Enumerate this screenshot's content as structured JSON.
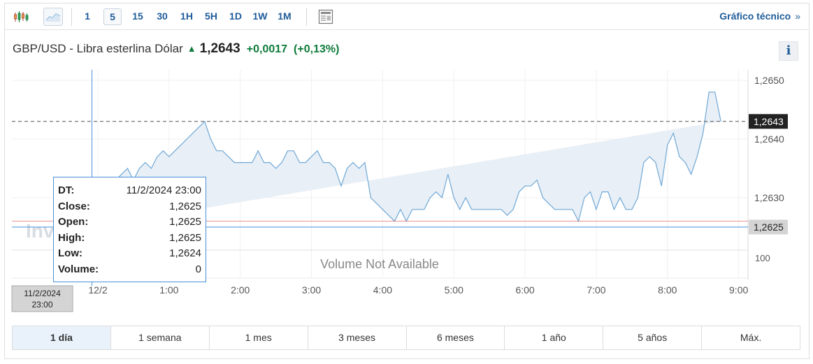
{
  "toolbar": {
    "intervals": [
      "1",
      "5",
      "15",
      "30",
      "1H",
      "5H",
      "1D",
      "1W",
      "1M"
    ],
    "active_interval": "5",
    "tech_link": "Gráfico técnico",
    "tech_link_chevron": "»"
  },
  "header": {
    "pair": "GBP/USD - Libra esterlina Dólar",
    "price": "1,2643",
    "change": "+0,0017",
    "change_pct": "(+0,13%)",
    "info": "i"
  },
  "colors": {
    "accent": "#1f5c99",
    "positive": "#0e7b3a",
    "line": "#6fa8d6",
    "area": "#e8eff6",
    "crosshair": "#4a90d9",
    "ref_line": "#e36b6b"
  },
  "chart_data": {
    "type": "area",
    "x_tick_labels": [
      "12/2",
      "1:00",
      "2:00",
      "3:00",
      "4:00",
      "5:00",
      "6:00",
      "7:00",
      "8:00",
      "9:00"
    ],
    "y_tick_labels": [
      "1,2650",
      "1,2640",
      "1,2630"
    ],
    "current_price_label": "1,2643",
    "crosshair_price_label": "1,2625",
    "crosshair_time_label": [
      "11/2/2024",
      "23:00"
    ],
    "volume_label": "Volume Not Available",
    "volume_axis_label": "100",
    "watermark": "Inv",
    "ylim": [
      1.2614,
      1.2655
    ],
    "x": [
      -0.0833,
      0.0,
      0.0833,
      0.1667,
      0.25,
      0.3333,
      0.4167,
      0.5,
      0.5833,
      0.6667,
      0.75,
      0.8333,
      0.9167,
      1.0,
      1.0833,
      1.1667,
      1.25,
      1.3333,
      1.4167,
      1.5,
      1.5833,
      1.6667,
      1.75,
      1.8333,
      1.9167,
      2.0,
      2.0833,
      2.1667,
      2.25,
      2.3333,
      2.4167,
      2.5,
      2.5833,
      2.6667,
      2.75,
      2.8333,
      2.9167,
      3.0,
      3.0833,
      3.1667,
      3.25,
      3.3333,
      3.4167,
      3.5,
      3.5833,
      3.6667,
      3.75,
      3.8333,
      3.9167,
      4.0,
      4.0833,
      4.1667,
      4.25,
      4.3333,
      4.4167,
      4.5,
      4.5833,
      4.6667,
      4.75,
      4.8333,
      4.9167,
      5.0,
      5.0833,
      5.1667,
      5.25,
      5.3333,
      5.4167,
      5.5,
      5.5833,
      5.6667,
      5.75,
      5.8333,
      5.9167,
      6.0,
      6.0833,
      6.1667,
      6.25,
      6.3333,
      6.4167,
      6.5,
      6.5833,
      6.6667,
      6.75,
      6.8333,
      6.9167,
      7.0,
      7.0833,
      7.1667,
      7.25,
      7.3333,
      7.4167,
      7.5,
      7.5833,
      7.6667,
      7.75,
      7.8333,
      7.9167,
      8.0,
      8.0833,
      8.1667,
      8.25,
      8.3333,
      8.4167,
      8.5,
      8.5833,
      8.6667,
      8.75,
      8.8333,
      8.9167,
      9.0
    ],
    "values": [
      1.2625,
      1.2628,
      1.263,
      1.2632,
      1.2633,
      1.2634,
      1.2635,
      1.2633,
      1.2635,
      1.2636,
      1.2635,
      1.2637,
      1.2638,
      1.2637,
      1.2638,
      1.2639,
      1.264,
      1.2641,
      1.2642,
      1.2643,
      1.264,
      1.2638,
      1.2638,
      1.2637,
      1.2636,
      1.2636,
      1.2636,
      1.2636,
      1.2638,
      1.2636,
      1.2636,
      1.2635,
      1.2636,
      1.2638,
      1.2638,
      1.2636,
      1.2636,
      1.2637,
      1.2638,
      1.2636,
      1.2636,
      1.2635,
      1.2632,
      1.2635,
      1.2636,
      1.2635,
      1.2636,
      1.263,
      1.2629,
      1.2628,
      1.2627,
      1.2626,
      1.2628,
      1.2626,
      1.2628,
      1.2628,
      1.2628,
      1.263,
      1.2631,
      1.263,
      1.2634,
      1.263,
      1.2628,
      1.263,
      1.2628,
      1.2628,
      1.2628,
      1.2628,
      1.2628,
      1.2628,
      1.2627,
      1.2628,
      1.2631,
      1.2632,
      1.2632,
      1.2633,
      1.263,
      1.2629,
      1.2628,
      1.2628,
      1.2628,
      1.2628,
      1.2626,
      1.263,
      1.2631,
      1.2628,
      1.2631,
      1.2631,
      1.2628,
      1.263,
      1.2628,
      1.2628,
      1.263,
      1.2636,
      1.2637,
      1.2636,
      1.2632,
      1.2639,
      1.2641,
      1.2637,
      1.2636,
      1.2634,
      1.2637,
      1.2641,
      1.2648,
      1.2648,
      1.2643
    ],
    "current_price": 1.2643,
    "crosshair_price": 1.2625,
    "ref_price": 1.2626,
    "grid": true
  },
  "tooltip": {
    "rows": [
      {
        "k": "DT:",
        "v": "11/2/2024 23:00"
      },
      {
        "k": "Close:",
        "v": "1,2625"
      },
      {
        "k": "Open:",
        "v": "1,2625"
      },
      {
        "k": "High:",
        "v": "1,2625"
      },
      {
        "k": "Low:",
        "v": "1,2624"
      },
      {
        "k": "Volume:",
        "v": "0"
      }
    ]
  },
  "ranges": {
    "items": [
      "1 día",
      "1 semana",
      "1 mes",
      "3 meses",
      "6 meses",
      "1 año",
      "5 años",
      "Máx."
    ],
    "active": "1 día"
  }
}
